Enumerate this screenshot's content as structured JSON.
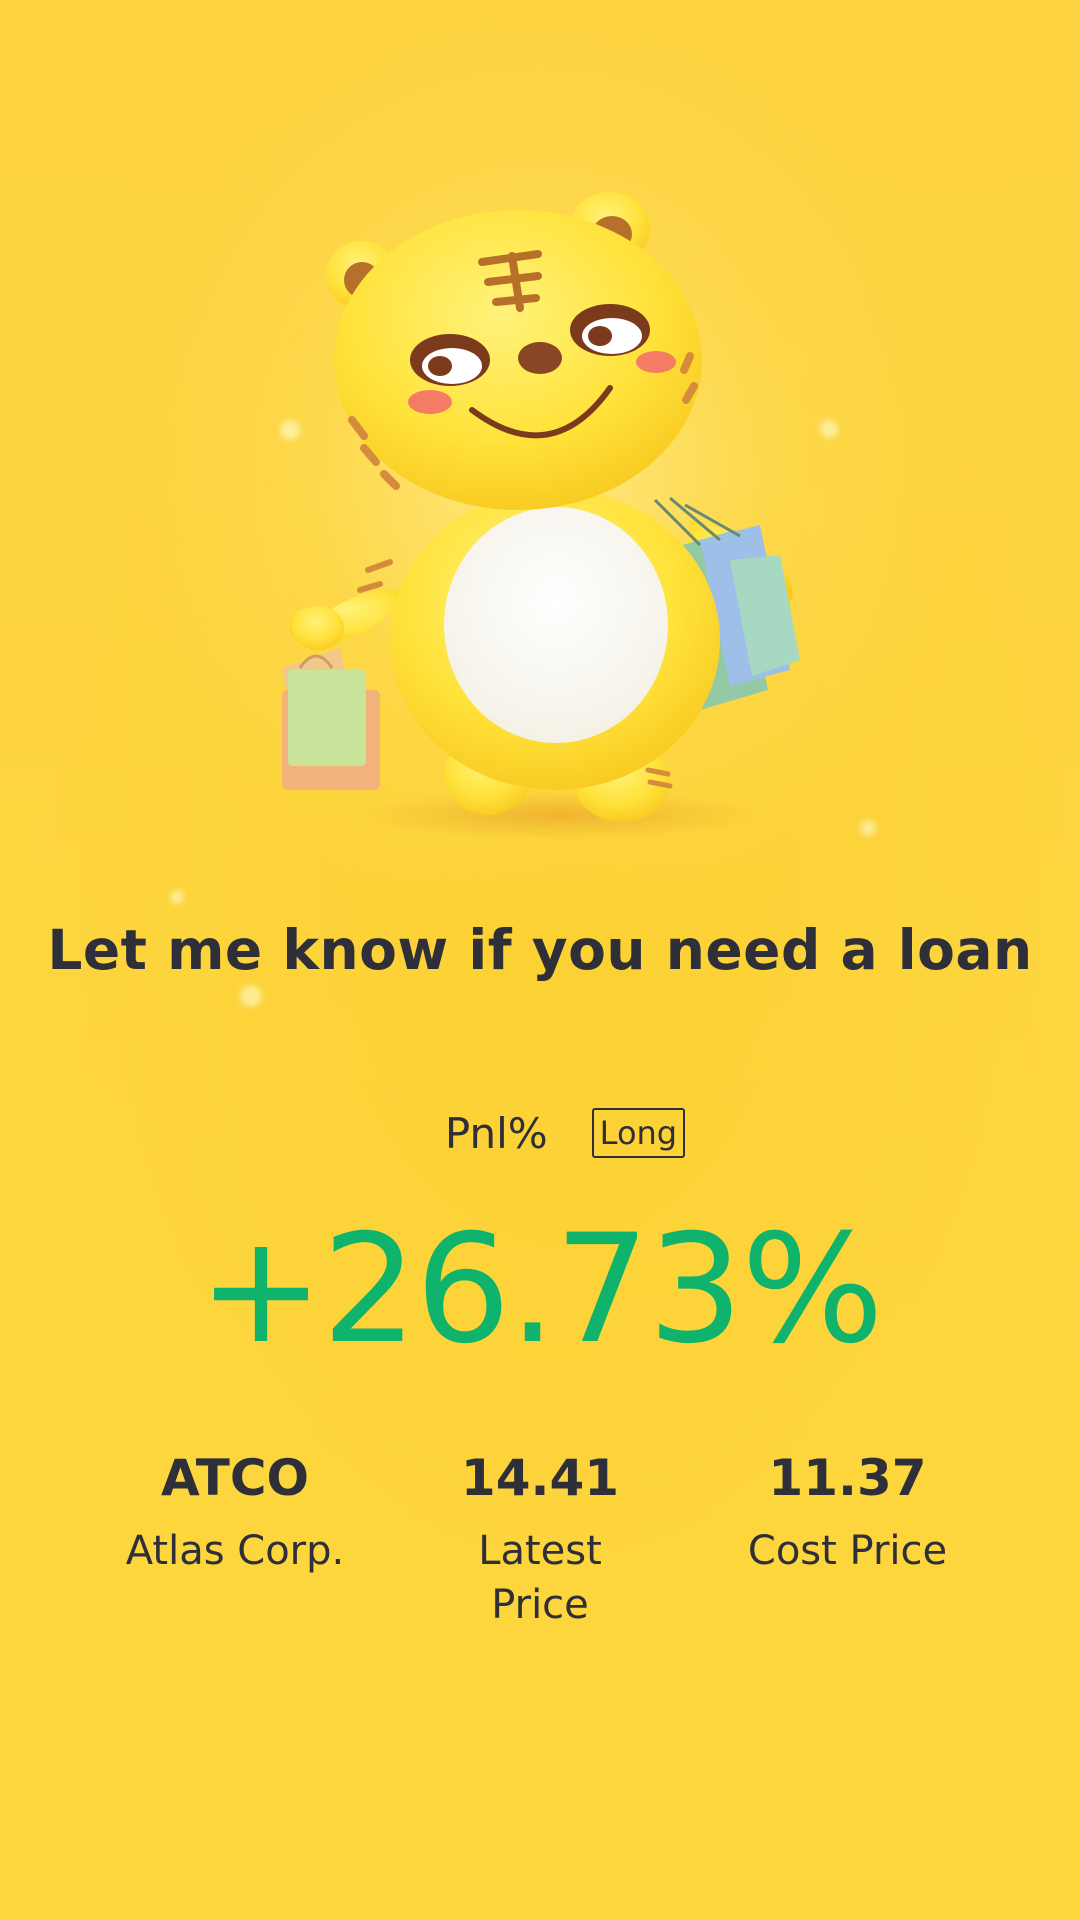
{
  "headline": "Let me know if you need a loan",
  "pnl": {
    "label": "Pnl%",
    "position_badge": "Long",
    "value": "+26.73%"
  },
  "stats": {
    "ticker": "ATCO",
    "company": "Atlas Corp.",
    "latest_price": "14.41",
    "latest_price_label": "Latest Price",
    "cost_price": "11.37",
    "cost_price_label": "Cost Price"
  },
  "colors": {
    "background": "#fdd33a",
    "text": "#2e2f38",
    "profit": "#0fb36b"
  },
  "illustration": "tiger-mascot-with-shopping-bags"
}
